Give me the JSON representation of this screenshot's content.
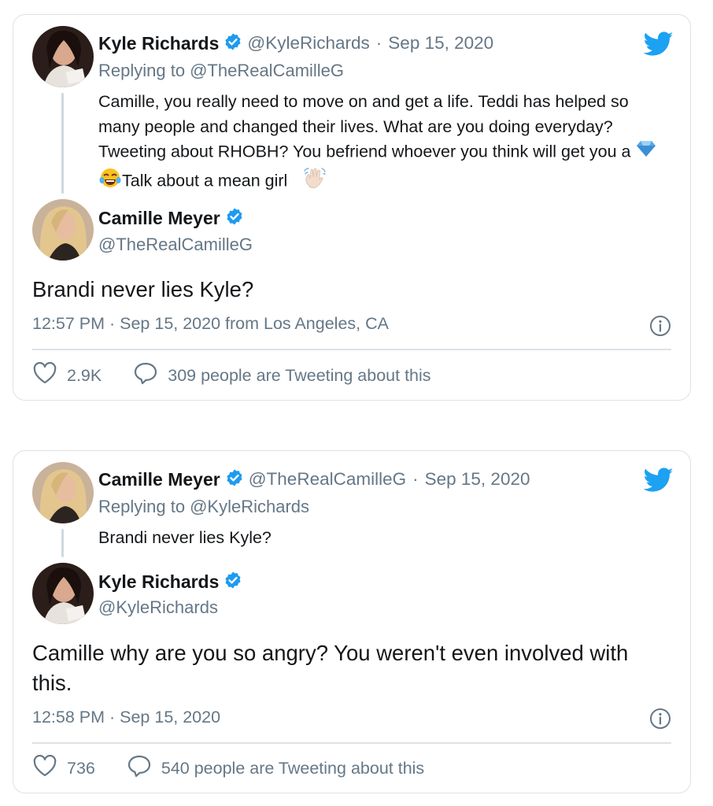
{
  "colors": {
    "twitter_blue": "#1da1f2",
    "verified_blue": "#1d9bf0",
    "text": "#14171a",
    "muted": "#657786",
    "border": "#dde2e6"
  },
  "tweets": [
    {
      "parent": {
        "name": "Kyle Richards",
        "handle": "@KyleRichards",
        "sep": "·",
        "date": "Sep 15, 2020",
        "replying_prefix": "Replying to",
        "replying_to": "@TheRealCamilleG",
        "text_main": "Camille, you really need to move on and get a life. Teddi has helped so many people and changed their lives. What are you doing everyday? Tweeting about RHOBH? You befriend whoever you think will get you a",
        "text_tail_1": "Talk about a mean girl",
        "emoji": [
          "gem-stone",
          "tears-of-joy",
          "waving-hand-light-skin"
        ]
      },
      "reply": {
        "name": "Camille Meyer",
        "handle": "@TheRealCamilleG",
        "text": "Brandi never lies Kyle?",
        "timestamp": "12:57 PM · Sep 15, 2020 from Los Angeles, CA",
        "likes": "2.9K",
        "talk": "309 people are Tweeting about this"
      }
    },
    {
      "parent": {
        "name": "Camille Meyer",
        "handle": "@TheRealCamilleG",
        "sep": "·",
        "date": "Sep 15, 2020",
        "replying_prefix": "Replying to",
        "replying_to": "@KyleRichards",
        "text_main": "Brandi never lies Kyle?"
      },
      "reply": {
        "name": "Kyle Richards",
        "handle": "@KyleRichards",
        "text": "Camille why are you so angry? You weren't even involved with this.",
        "timestamp": "12:58 PM · Sep 15, 2020",
        "likes": "736",
        "talk": "540 people are Tweeting about this"
      }
    }
  ]
}
